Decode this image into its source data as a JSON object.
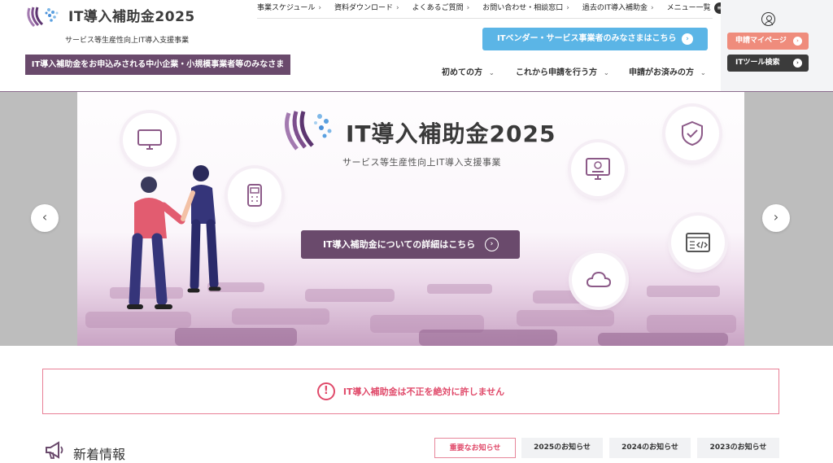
{
  "header": {
    "logo_title": "IT導入補助金2025",
    "logo_subtitle": "サービス等生産性向上IT導入支援事業",
    "sme_banner": "IT導入補助金をお申込みされる中小企業・小規模事業者等のみなさま",
    "top_links": [
      "事業スケジュール",
      "資料ダウンロード",
      "よくあるご質問",
      "お問い合わせ・相談窓口",
      "過去のIT導入補助金"
    ],
    "menu_label": "メニュー一覧",
    "vendor_button": "ITベンダー・サービス事業者のみなさまはこちら",
    "nav": [
      "初めての方",
      "これから申請を行う方",
      "申請がお済みの方"
    ]
  },
  "side": {
    "mypage_button": "申請マイページ",
    "tool_search_button": "ITツール検索"
  },
  "hero": {
    "title": "IT導入補助金2025",
    "subtitle": "サービス等生産性向上IT導入支援事業",
    "detail_button": "IT導入補助金についての詳細はこちら"
  },
  "alert": {
    "text": "IT導入補助金は不正を絶対に許しません"
  },
  "news": {
    "title": "新着情報",
    "tabs": [
      "重要なお知らせ",
      "2025のお知らせ",
      "2024のお知らせ",
      "2023のお知らせ"
    ]
  },
  "colors": {
    "brand_purple": "#6a4a6c",
    "vendor_blue": "#5bb5e6",
    "mypage_coral": "#ef8c7c",
    "alert_red": "#e04a6a"
  }
}
